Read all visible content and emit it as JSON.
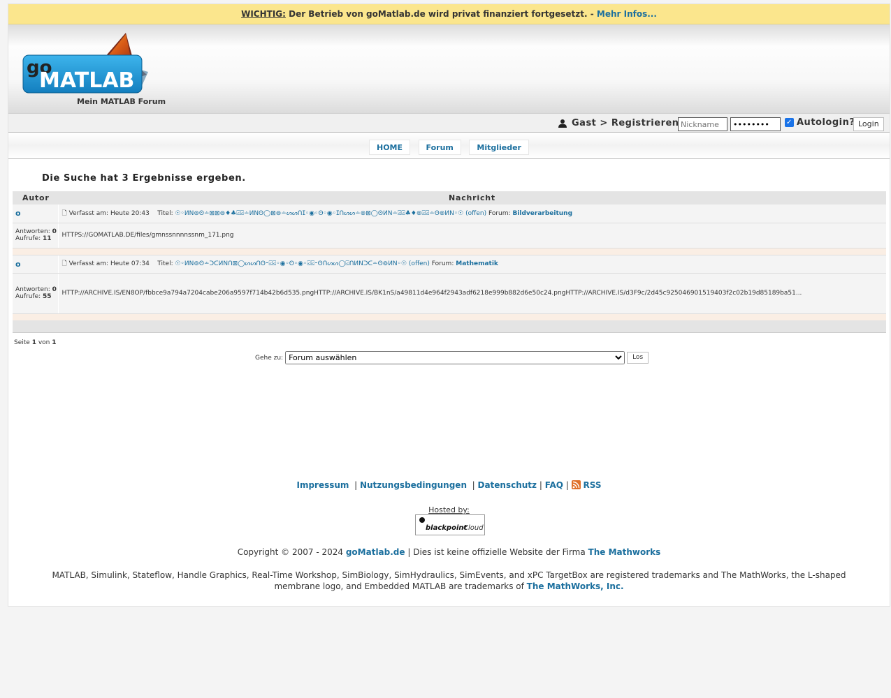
{
  "notice": {
    "label": "WICHTIG:",
    "text": " Der Betrieb von goMatlab.de wird privat finanziert fortgesetzt. - ",
    "link": "Mehr Infos..."
  },
  "header": {
    "logo_text_go": "go",
    "logo_text_matlab": "MATLAB",
    "tagline": "Mein MATLAB Forum"
  },
  "login": {
    "user_text": "Gast > Registrieren",
    "nickname_placeholder": "Nickname",
    "password_value": "********",
    "autologin_label": "Autologin?",
    "login_button": "Login"
  },
  "nav": {
    "tabs": [
      "HOME",
      "Forum",
      "Mitglieder"
    ]
  },
  "search": {
    "title": "Die Suche hat 3 Ergebnisse ergeben.",
    "columns": [
      "Autor",
      "Nachricht"
    ],
    "results": [
      {
        "author": "o",
        "replies_label": "Antworten:",
        "replies": "0",
        "views_label": "Aufrufe:",
        "views": "11",
        "posted": "Verfasst am: Heute 20:43",
        "title_label": "Titel:",
        "title": "☉◦ИN⊚ʘ∸⊠⊠⊚♦♣⍃⍃∸ИNʘ◯⊠⊚∸ᔕᔕᑎⵊ◦◉◦ʘ◦◉◦ⵊᑎᔕᔕ∸⊚⊠◯ʘИN∸⍃⍃♣♦⊚⍃⍃∸ʘ⊚ИN◦☉",
        "status": "(offen)",
        "forum_label": "Forum:",
        "forum": "Bildverarbeitung",
        "message": "HTTPS://GOMATLAB.DE/files/gmnssnnnnssnm_171.png"
      },
      {
        "author": "o",
        "replies_label": "Antworten:",
        "replies": "0",
        "views_label": "Aufrufe:",
        "views": "55",
        "posted": "Verfasst am: Heute 07:34",
        "title_label": "Titel:",
        "title": "☉◦ИN⊚ʘ∸ᑐᑕИNᑎ⊠◯ᔕᔕᑎʘ⁃⍃⍃◦◉◦ʘ◦◉◦⍃⍃⁃ʘᑎᔕᔕ◯⍃ᑎИNᑐᑕ∸ʘ⊚ИN◦☉",
        "status": "(offen)",
        "forum_label": "Forum:",
        "forum": "Mathematik",
        "message": "HTTP://ARCHIVE.IS/EN8OP/fbbce9a794a7204cabe206a9597f714b42b6d535.pngHTTP://ARCHIVE.IS/BK1nS/a49811d4e964f2943adf6218e999b882d6e50c24.pngHTTP://ARCHIVE.IS/d3F9c/2d45c925046901519403f2c02b19d85189ba51...",
        "message_more": "..."
      }
    ],
    "page_info": {
      "prefix": "Seite",
      "page": "1",
      "of": "von",
      "total": "1"
    },
    "jump": {
      "label": "Gehe zu:",
      "selected": "Forum auswählen",
      "button": "Los"
    }
  },
  "footer": {
    "links": [
      "Impressum",
      "Nutzungsbedingungen",
      "Datenschutz",
      "FAQ",
      "RSS"
    ],
    "hosted_by": "Hosted by:",
    "host_name": "blackpoint",
    "host_suffix": "Cloud",
    "copyright_prefix": "Copyright © 2007 - 2024 ",
    "copyright_site": "goMatlab.de",
    "copyright_mid": " | Dies ist keine offizielle Website der Firma ",
    "copyright_company": "The Mathworks",
    "trademark_text": "MATLAB, Simulink, Stateflow, Handle Graphics, Real-Time Workshop, SimBiology, SimHydraulics, SimEvents, and xPC TargetBox are registered trademarks and The MathWorks, the L-shaped membrane logo, and Embedded MATLAB are trademarks of ",
    "trademark_company": "The MathWorks, Inc."
  },
  "colors": {
    "notice_bg": "#fbe68d",
    "link": "#1b6f9e",
    "logo_blue": "#1e9ad6"
  }
}
